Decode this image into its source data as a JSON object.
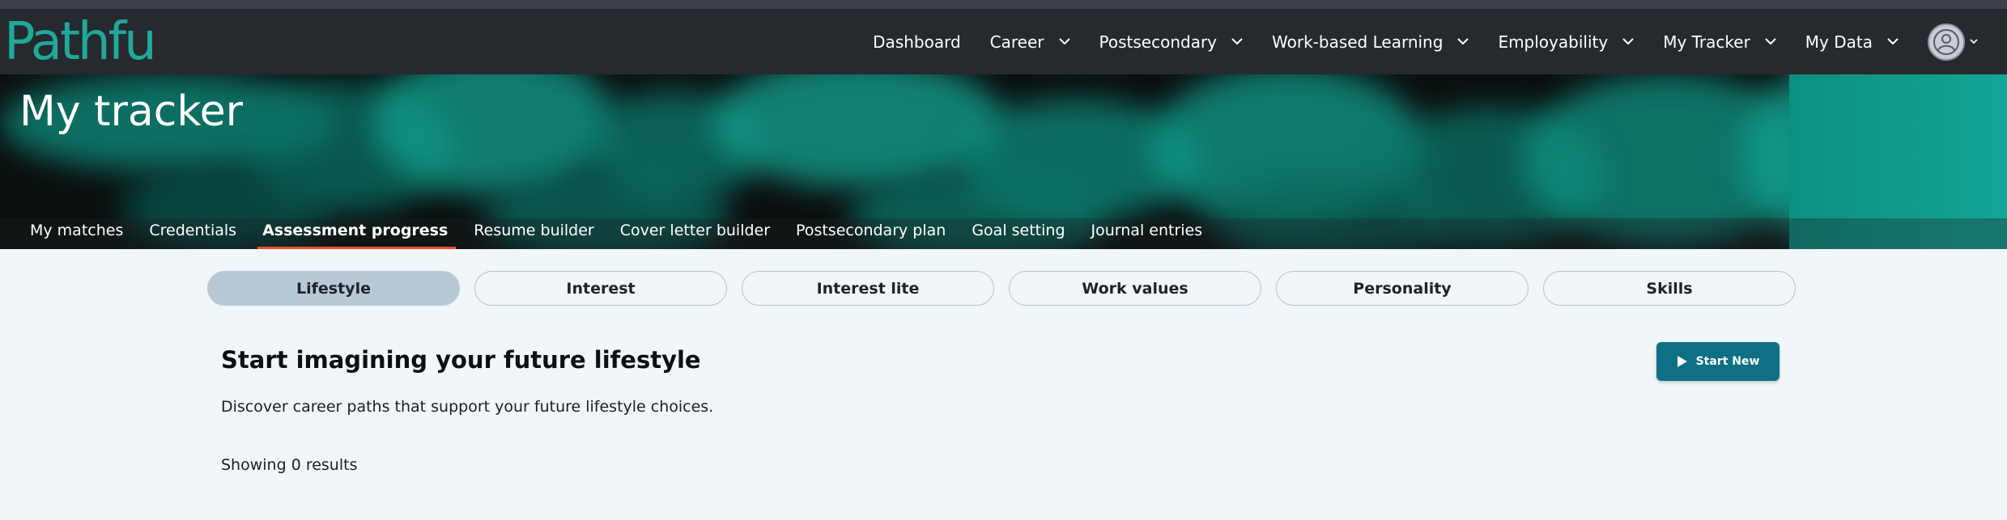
{
  "brand": {
    "logo_text": "Pathful",
    "color": "#1fa99a"
  },
  "nav": {
    "items": [
      {
        "label": "Dashboard",
        "dropdown": false
      },
      {
        "label": "Career",
        "dropdown": true
      },
      {
        "label": "Postsecondary",
        "dropdown": true
      },
      {
        "label": "Work-based Learning",
        "dropdown": true
      },
      {
        "label": "Employability",
        "dropdown": true
      },
      {
        "label": "My Tracker",
        "dropdown": true
      },
      {
        "label": "My Data",
        "dropdown": true
      }
    ],
    "avatar_icon": "user-avatar-icon"
  },
  "hero": {
    "title": "My tracker",
    "tabs": [
      {
        "label": "My matches"
      },
      {
        "label": "Credentials"
      },
      {
        "label": "Assessment progress",
        "active": true
      },
      {
        "label": "Resume builder"
      },
      {
        "label": "Cover letter builder"
      },
      {
        "label": "Postsecondary plan"
      },
      {
        "label": "Goal setting"
      },
      {
        "label": "Journal entries"
      }
    ],
    "active_tab_accent": "#e8502b"
  },
  "assessments": {
    "tabs": [
      {
        "label": "Lifestyle",
        "active": true
      },
      {
        "label": "Interest"
      },
      {
        "label": "Interest lite"
      },
      {
        "label": "Work values"
      },
      {
        "label": "Personality"
      },
      {
        "label": "Skills"
      }
    ]
  },
  "content": {
    "heading": "Start imagining your future lifestyle",
    "description": "Discover career paths that support your future lifestyle choices.",
    "results_text": "Showing 0 results",
    "start_button": {
      "label": "Start New",
      "icon": "play-icon",
      "color": "#0e6f85"
    }
  }
}
